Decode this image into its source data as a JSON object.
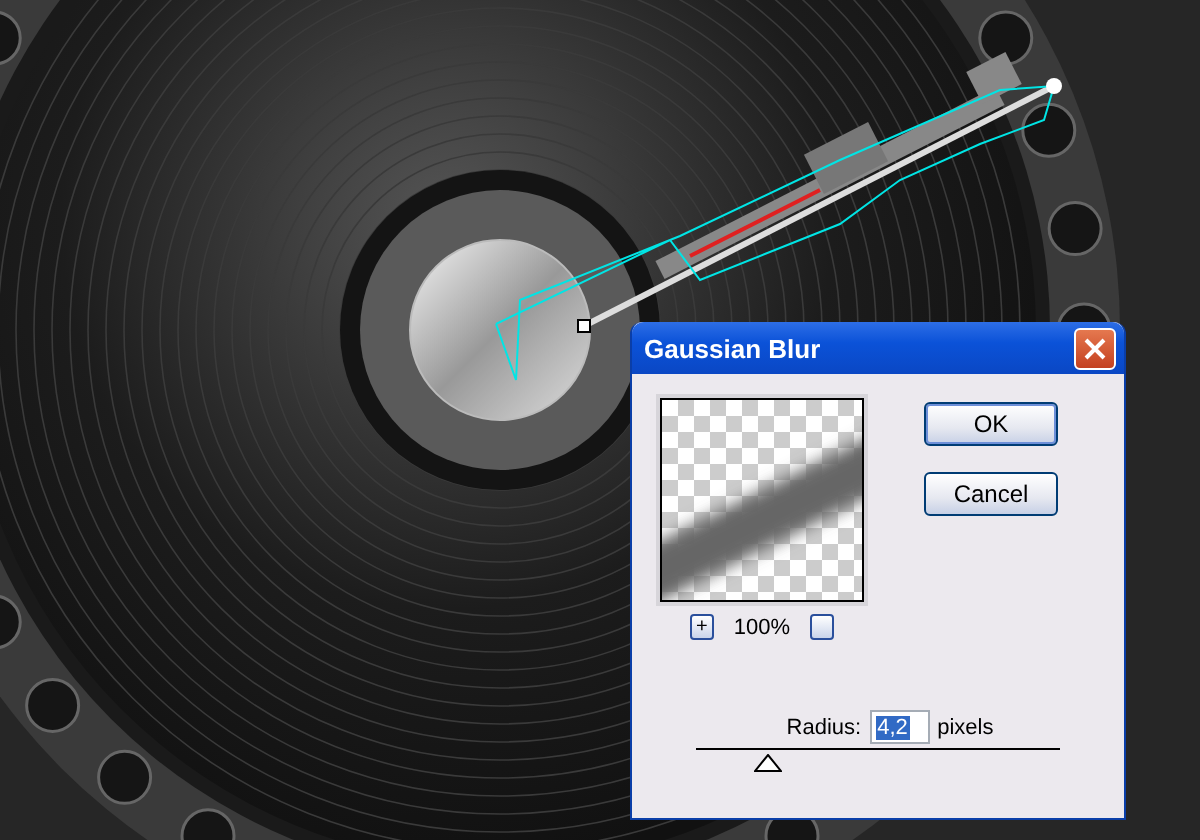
{
  "dialog": {
    "title": "Gaussian Blur",
    "preview": {
      "zoom_in": "+",
      "zoom": "100%"
    },
    "buttons": [
      "OK",
      "Cancel"
    ],
    "radius": {
      "label": "Radius:",
      "value": "4,2",
      "selected": true,
      "unit": "pixels",
      "level": 0.2
    }
  }
}
